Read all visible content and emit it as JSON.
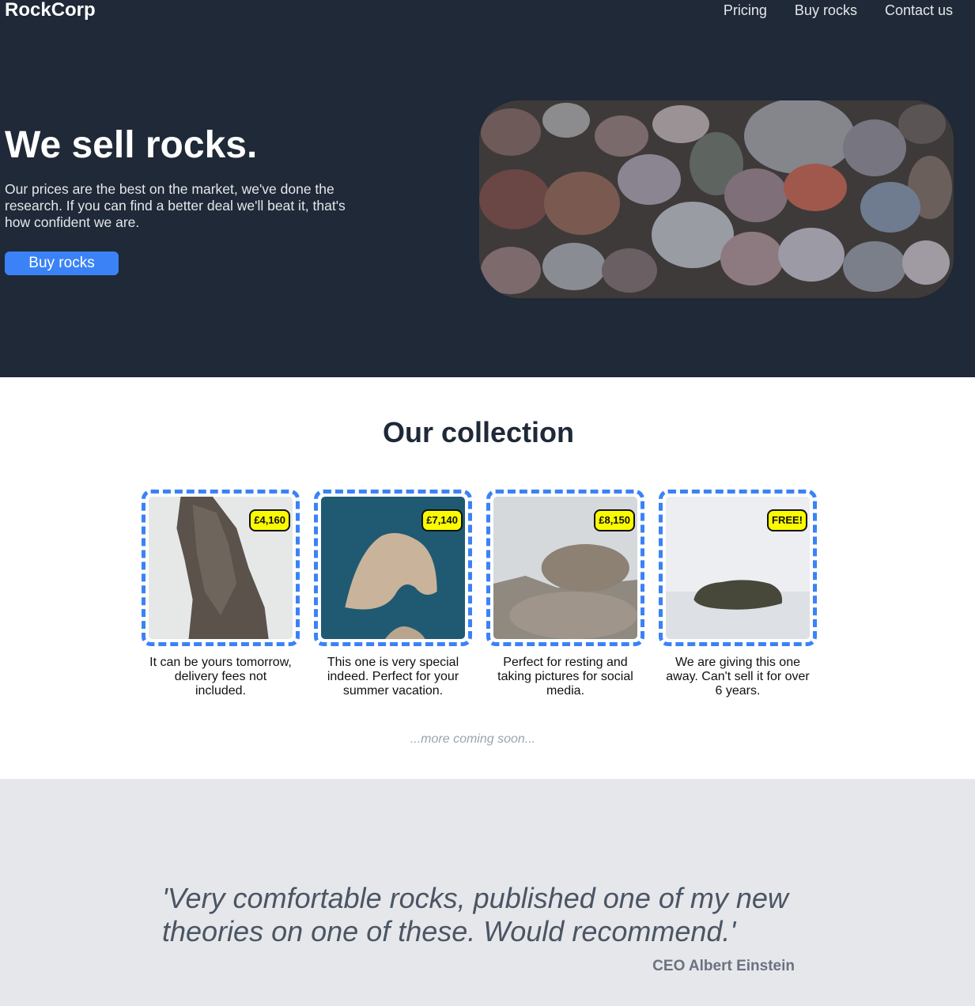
{
  "header": {
    "brand": "RockCorp",
    "nav": [
      "Pricing",
      "Buy rocks",
      "Contact us"
    ]
  },
  "hero": {
    "title": "We sell rocks.",
    "text": "Our prices are the best on the market, we've done the research. If you can find a better deal we'll beat it, that's how confident we are.",
    "button": "Buy rocks",
    "image": "pebbles-photo"
  },
  "collection": {
    "title": "Our collection",
    "items": [
      {
        "price": "£4,160",
        "description": "It can be yours tomorrow, delivery fees not included.",
        "image": "tall-rock-pillar-photo"
      },
      {
        "price": "£7,140",
        "description": "This one is very special indeed. Perfect for your summer vacation.",
        "image": "sea-arch-rock-photo"
      },
      {
        "price": "£8,150",
        "description": "Perfect for resting and taking pictures for social media.",
        "image": "balanced-boulder-photo"
      },
      {
        "price": "FREE!",
        "description": "We are giving this one away. Can't sell it for over 6 years.",
        "image": "rock-in-fog-photo"
      }
    ],
    "more": "...more coming soon..."
  },
  "testimonial": {
    "quote": "'Very comfortable rocks, published one of my new theories on one of these. Would recommend.'",
    "author": "CEO Albert Einstein"
  },
  "colors": {
    "dark": "#1f2937",
    "accent": "#3b82f6",
    "badge": "#fafb00",
    "light_gray": "#e5e7eb"
  }
}
